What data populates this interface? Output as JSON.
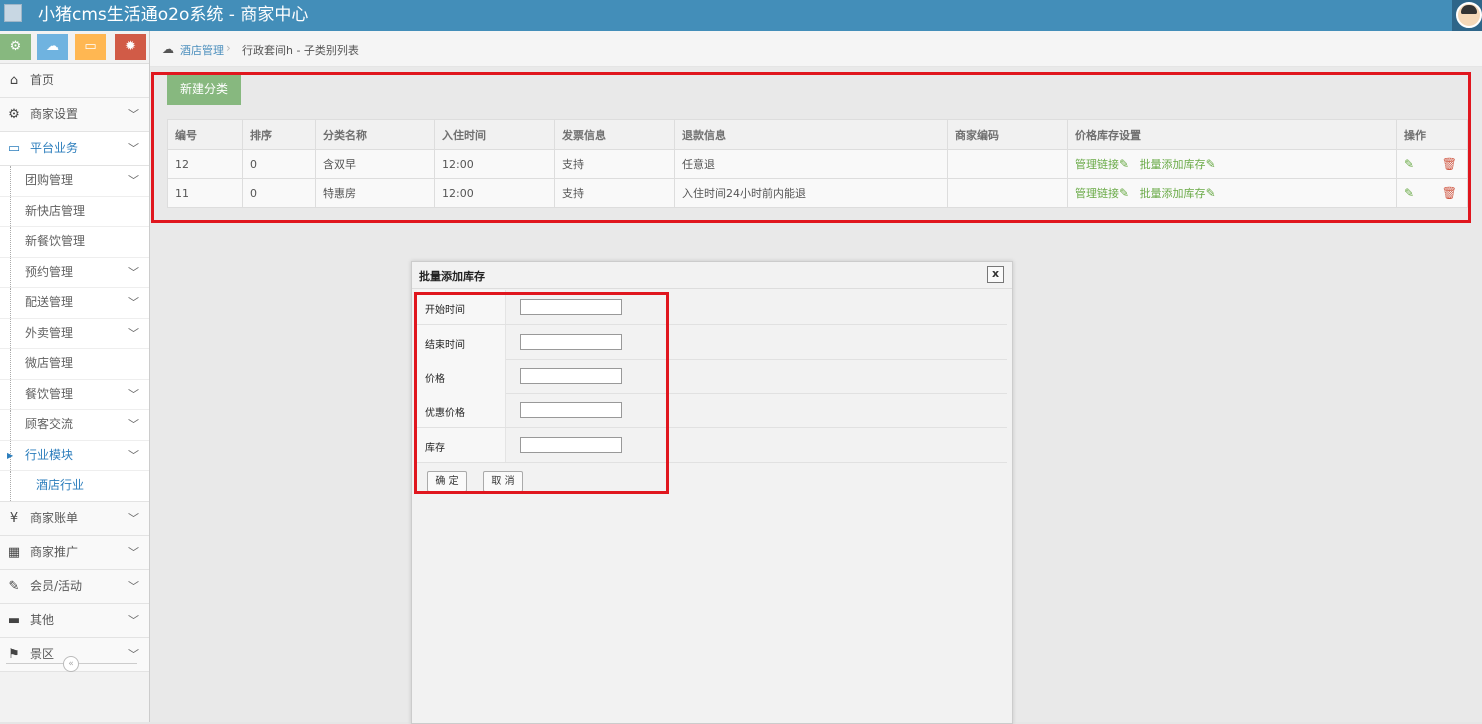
{
  "navbar": {
    "brand": "小猪cms生活通o2o系统 - 商家中心"
  },
  "shortcuts": [
    {
      "icon": "⚙",
      "color": "#6fb3e0"
    },
    {
      "icon": "☁",
      "color": "#6fb3e0"
    },
    {
      "icon": "▭",
      "color": "#fee188"
    },
    {
      "icon": "✹",
      "color": "#d15b47"
    }
  ],
  "sidebar": {
    "items": [
      {
        "label": "首页"
      },
      {
        "label": "商家设置"
      },
      {
        "label": "平台业务"
      }
    ],
    "subitems": [
      {
        "label": "团购管理"
      },
      {
        "label": "新快店管理"
      },
      {
        "label": "新餐饮管理"
      },
      {
        "label": "预约管理"
      },
      {
        "label": "配送管理"
      },
      {
        "label": "外卖管理"
      },
      {
        "label": "微店管理"
      },
      {
        "label": "餐饮管理"
      },
      {
        "label": "顾客交流"
      },
      {
        "label": "行业模块"
      }
    ],
    "subsub": {
      "label": "酒店行业"
    },
    "bottom_items": [
      {
        "label": "商家账单"
      },
      {
        "label": "商家推广"
      },
      {
        "label": "会员/活动"
      },
      {
        "label": "其他"
      },
      {
        "label": "景区"
      }
    ],
    "collapse_glyph": "«"
  },
  "breadcrumb": {
    "level1": "酒店管理",
    "separator": "›",
    "level2": "行政套间h - 子类别列表"
  },
  "toolbar": {
    "add_label": "新建分类"
  },
  "table": {
    "headers": [
      "编号",
      "排序",
      "分类名称",
      "入住时间",
      "发票信息",
      "退款信息",
      "商家编码",
      "价格库存设置",
      "操作"
    ],
    "rows": [
      {
        "id": "12",
        "sort": "0",
        "name": "含双早",
        "checkin": "12:00",
        "invoice": "支持",
        "refund": "任意退",
        "code": "",
        "link1": "管理链接",
        "link2": "批量添加库存"
      },
      {
        "id": "11",
        "sort": "0",
        "name": "特惠房",
        "checkin": "12:00",
        "invoice": "支持",
        "refund": "入住时间24小时前内能退",
        "code": "",
        "link1": "管理链接",
        "link2": "批量添加库存"
      }
    ]
  },
  "modal": {
    "title": "批量添加库存",
    "close": "x",
    "fields": [
      {
        "label": "开始时间",
        "value": ""
      },
      {
        "label": "结束时间",
        "value": ""
      },
      {
        "label": "价格",
        "value": ""
      },
      {
        "label": "优惠价格",
        "value": ""
      },
      {
        "label": "库存",
        "value": ""
      }
    ],
    "confirm": "确 定",
    "cancel": "取 消"
  }
}
